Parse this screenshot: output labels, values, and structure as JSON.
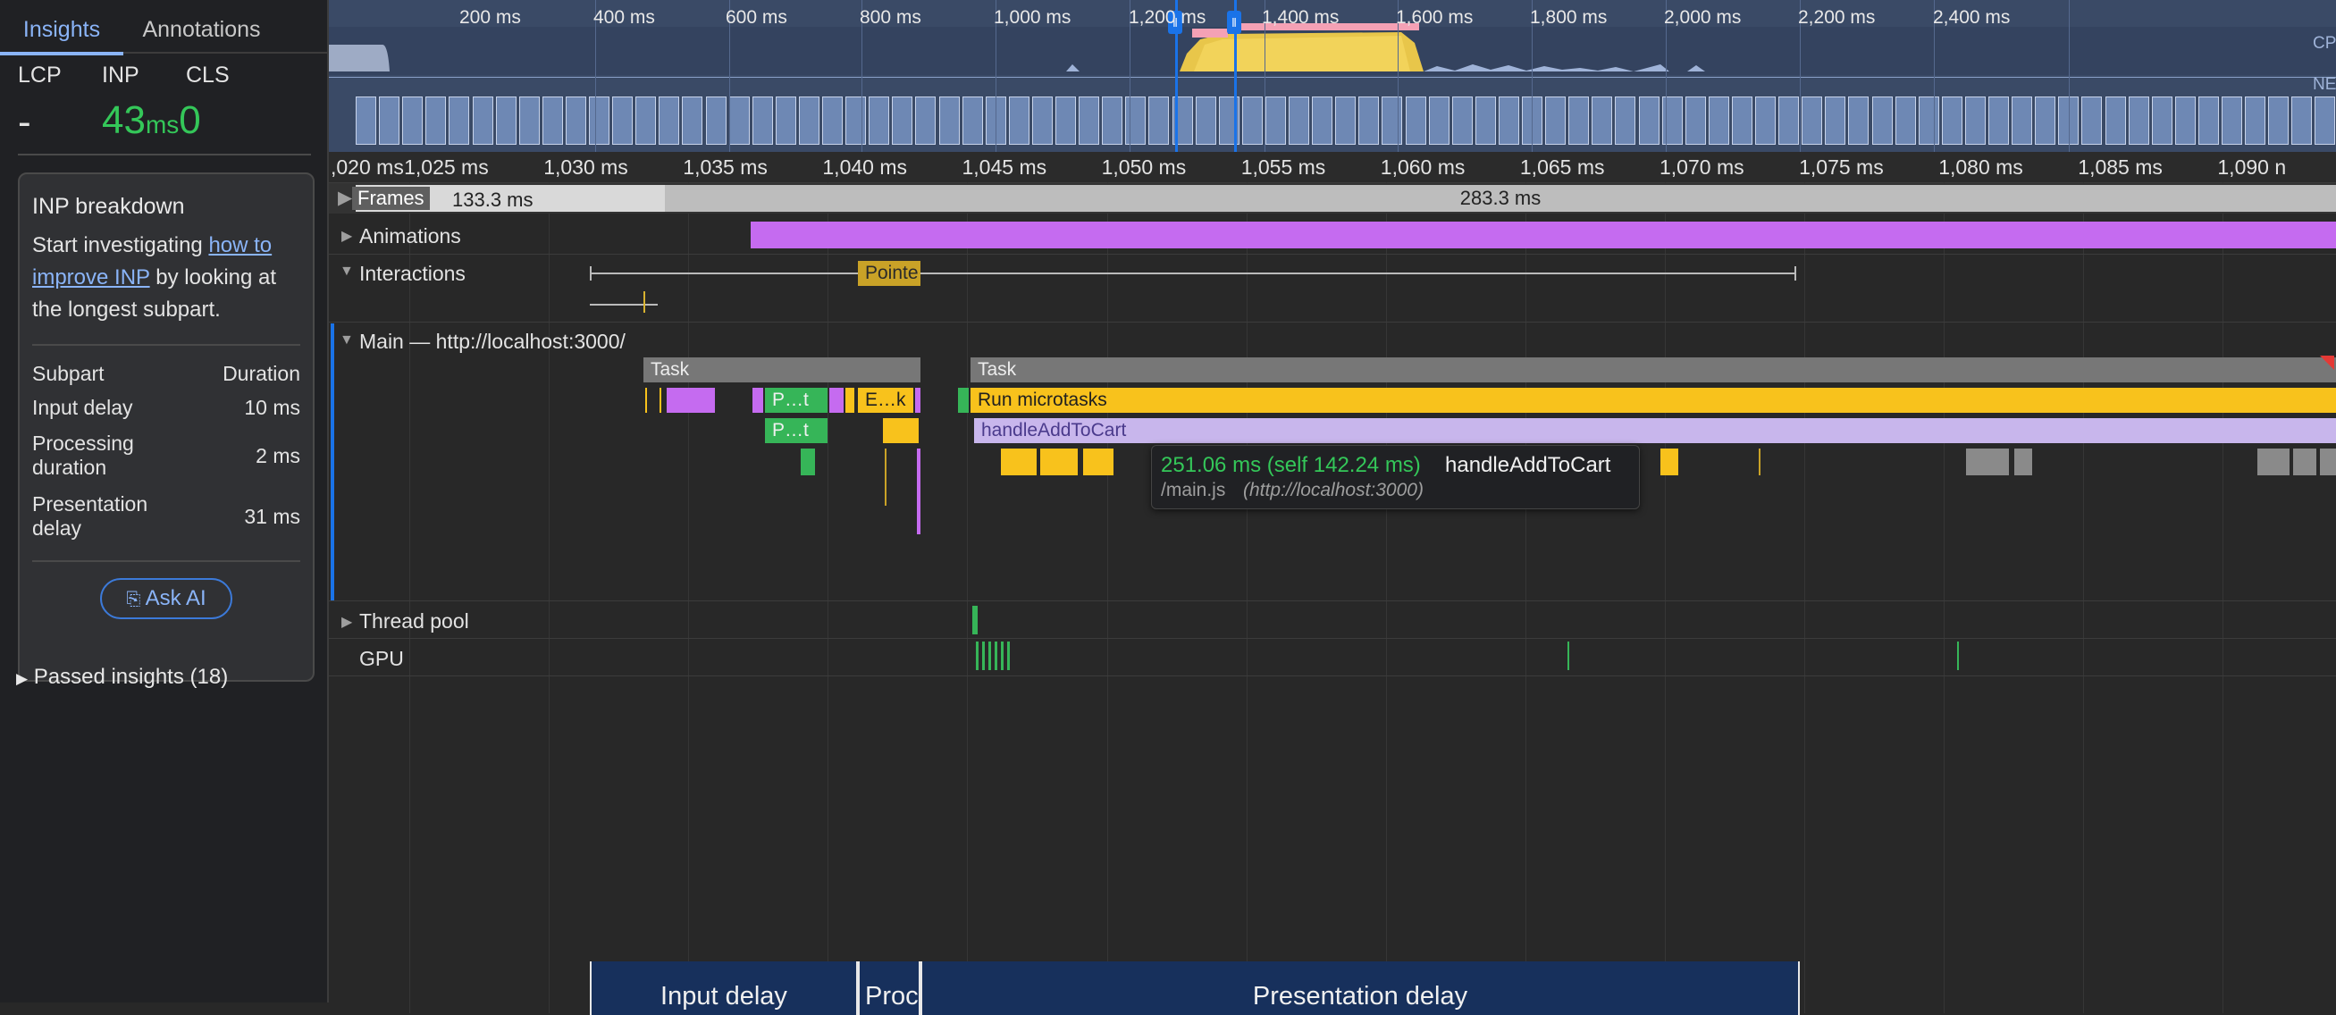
{
  "sidebar": {
    "tabs": [
      {
        "label": "Insights"
      },
      {
        "label": "Annotations"
      }
    ],
    "metrics": {
      "lcp_label": "LCP",
      "lcp_value": "-",
      "inp_label": "INP",
      "inp_value": "43",
      "inp_unit": "ms",
      "cls_label": "CLS",
      "cls_value": "0"
    },
    "card": {
      "title": "INP breakdown",
      "text_before": "Start investigating ",
      "link": "how to improve INP",
      "text_after": " by looking at the longest subpart.",
      "header_subpart": "Subpart",
      "header_duration": "Duration",
      "rows": [
        {
          "label": "Input delay",
          "value": "10 ms"
        },
        {
          "label": "Processing duration",
          "value": "2 ms"
        },
        {
          "label": "Presentation delay",
          "value": "31 ms"
        }
      ],
      "ask_ai": "Ask AI"
    },
    "passed": "Passed insights (18)"
  },
  "overview": {
    "ticks": [
      "200 ms",
      "400 ms",
      "600 ms",
      "800 ms",
      "1,000 ms",
      "1,200 ms",
      "1,400 ms",
      "1,600 ms",
      "1,800 ms",
      "2,000 ms",
      "2,200 ms",
      "2,400 ms"
    ],
    "cpu_label": "CPU",
    "net_label": "NET"
  },
  "ruler": {
    "ticks": [
      ",020 ms",
      "1,025 ms",
      "1,030 ms",
      "1,035 ms",
      "1,040 ms",
      "1,045 ms",
      "1,050 ms",
      "1,055 ms",
      "1,060 ms",
      "1,065 ms",
      "1,070 ms",
      "1,075 ms",
      "1,080 ms",
      "1,085 ms",
      "1,090 n"
    ]
  },
  "tracks": {
    "frames": {
      "label": "Frames",
      "frame1": "133.3 ms",
      "frame2": "283.3 ms"
    },
    "animations": {
      "label": "Animations"
    },
    "interactions": {
      "label": "Interactions",
      "event": "Pointe"
    },
    "main": {
      "label": "Main — http://localhost:3000/",
      "task1": "Task",
      "task2": "Task",
      "ev_pt1": "P…t",
      "ev_ek": "E…k",
      "ev_pt2": "P…t",
      "run_microtasks": "Run microtasks",
      "handler": "handleAddToCart"
    },
    "threadpool": {
      "label": "Thread pool"
    },
    "gpu": {
      "label": "GPU"
    }
  },
  "tooltip": {
    "time": "251.06 ms (self 142.24 ms)",
    "name": "handleAddToCart",
    "file": "/main.js",
    "origin": "(http://localhost:3000)"
  },
  "phases": {
    "input_delay": "Input delay",
    "processing": "Proc",
    "presentation": "Presentation delay"
  },
  "colors": {
    "accent": "#8ab4f8",
    "good": "#34c759",
    "task": "#777777",
    "scripting": "#f8c21c",
    "rendering": "#c56bf0",
    "painting": "#36b558"
  }
}
